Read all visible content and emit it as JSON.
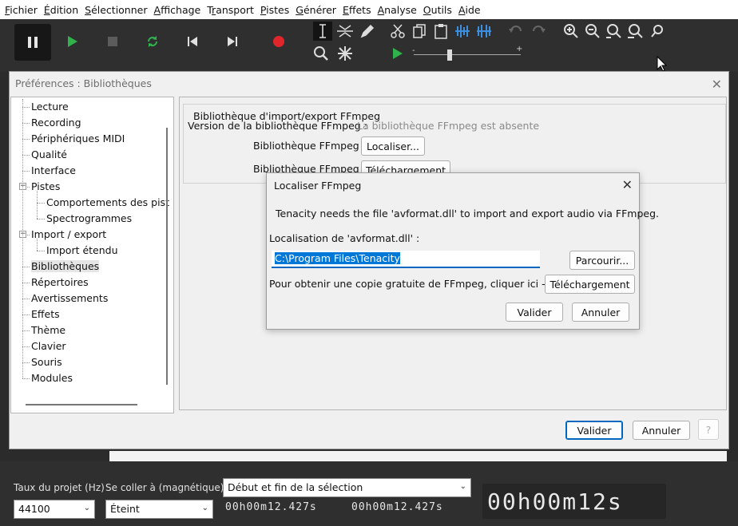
{
  "menubar": {
    "items": [
      {
        "pre": "",
        "ul": "F",
        "post": "ichier"
      },
      {
        "pre": "",
        "ul": "É",
        "post": "dition"
      },
      {
        "pre": "",
        "ul": "S",
        "post": "électionner"
      },
      {
        "pre": "",
        "ul": "A",
        "post": "ffichage"
      },
      {
        "pre": "T",
        "ul": "r",
        "post": "ansport"
      },
      {
        "pre": "",
        "ul": "P",
        "post": "istes"
      },
      {
        "pre": "",
        "ul": "G",
        "post": "énérer"
      },
      {
        "pre": "",
        "ul": "E",
        "post": "ffets"
      },
      {
        "pre": "",
        "ul": "A",
        "post": "nalyse"
      },
      {
        "pre": "",
        "ul": "O",
        "post": "utils"
      },
      {
        "pre": "",
        "ul": "A",
        "post": "ide"
      }
    ]
  },
  "toolbar": {
    "transport": [
      "pause-icon",
      "play-icon",
      "stop-icon",
      "loop-icon",
      "skip-start-icon",
      "skip-end-icon",
      "record-icon"
    ],
    "colors": {
      "play": "#2fb34a",
      "record": "#e0262b",
      "bg": "#2f2f2f"
    }
  },
  "prefs": {
    "title": "Préférences : Bibliothèques",
    "close": "✕",
    "tree": [
      {
        "label": "Lecture",
        "level": 0
      },
      {
        "label": "Recording",
        "level": 0
      },
      {
        "label": "Périphériques MIDI",
        "level": 0
      },
      {
        "label": "Qualité",
        "level": 0
      },
      {
        "label": "Interface",
        "level": 0
      },
      {
        "label": "Pistes",
        "level": 0,
        "expander": "−"
      },
      {
        "label": "Comportements des pist",
        "level": 1
      },
      {
        "label": "Spectrogrammes",
        "level": 1
      },
      {
        "label": "Import / export",
        "level": 0,
        "expander": "−"
      },
      {
        "label": "Import étendu",
        "level": 1
      },
      {
        "label": "Bibliothèques",
        "level": 0,
        "selected": true
      },
      {
        "label": "Répertoires",
        "level": 0
      },
      {
        "label": "Avertissements",
        "level": 0
      },
      {
        "label": "Effets",
        "level": 0
      },
      {
        "label": "Thème",
        "level": 0
      },
      {
        "label": "Clavier",
        "level": 0
      },
      {
        "label": "Souris",
        "level": 0
      },
      {
        "label": "Modules",
        "level": 0
      }
    ],
    "group_label": "Bibliothèque d'import/export FFmpeg",
    "version_label": "Version de la bibliothèque FFmpeg :",
    "version_value": "La bibliothèque FFmpeg est absente",
    "lib_label_1": "Bibliothèque FFmpeg :",
    "locate_button": "Localiser...",
    "lib_label_2": "Bibliothèque FFmpeg :",
    "download_button": "Téléchargement",
    "ok_button": "Valider",
    "cancel_button": "Annuler",
    "help_button": "?"
  },
  "modal": {
    "title": "Localiser FFmpeg",
    "close": "✕",
    "message": "Tenacity needs the file 'avformat.dll' to import and export audio via FFmpeg.",
    "location_label": "Localisation de 'avformat.dll' :",
    "path_value": "C:\\Program Files\\Tenacity",
    "browse_button": "Parcourir...",
    "copy_label": "Pour obtenir une copie gratuite de FFmpeg, cliquer ici -->",
    "download_button": "Téléchargement",
    "ok_button": "Valider",
    "cancel_button": "Annuler"
  },
  "bottom": {
    "rate_label": "Taux du projet (Hz)",
    "snap_label": "Se coller à (magnétique)",
    "selection_mode": "Début et fin de la sélection",
    "rate_value": "44100",
    "snap_value": "Éteint",
    "sel_start": "00h00m12.427s",
    "sel_end": "00h00m12.427s",
    "time_big": "00h00m12s"
  }
}
